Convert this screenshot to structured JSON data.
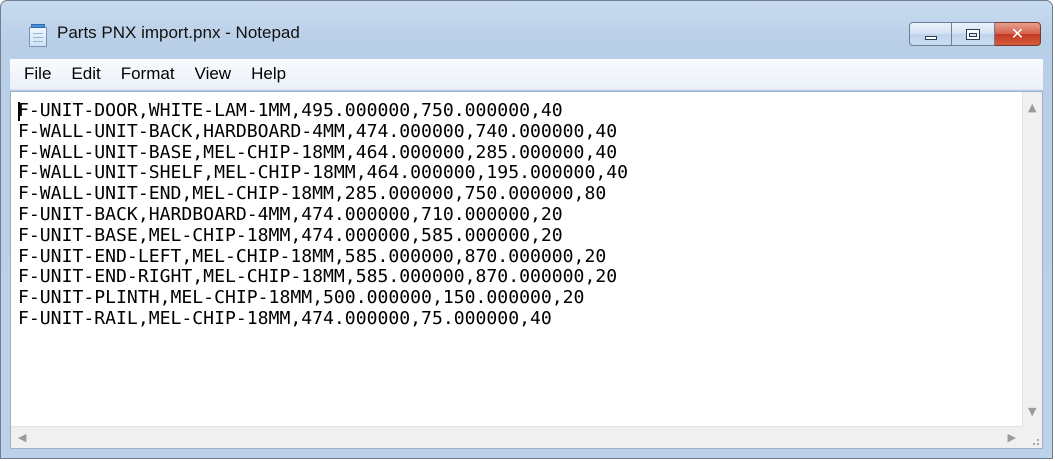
{
  "window": {
    "title": "Parts PNX import.pnx - Notepad",
    "icon": "notepad-icon",
    "controls": {
      "minimize_icon": "minimize-icon",
      "maximize_icon": "maximize-icon",
      "close_icon": "close-icon",
      "close_glyph": "✕"
    }
  },
  "menu": {
    "items": [
      {
        "label": "File"
      },
      {
        "label": "Edit"
      },
      {
        "label": "Format"
      },
      {
        "label": "View"
      },
      {
        "label": "Help"
      }
    ]
  },
  "editor": {
    "lines": [
      "F-UNIT-DOOR,WHITE-LAM-1MM,495.000000,750.000000,40",
      "F-WALL-UNIT-BACK,HARDBOARD-4MM,474.000000,740.000000,40",
      "F-WALL-UNIT-BASE,MEL-CHIP-18MM,464.000000,285.000000,40",
      "F-WALL-UNIT-SHELF,MEL-CHIP-18MM,464.000000,195.000000,40",
      "F-WALL-UNIT-END,MEL-CHIP-18MM,285.000000,750.000000,80",
      "F-UNIT-BACK,HARDBOARD-4MM,474.000000,710.000000,20",
      "F-UNIT-BASE,MEL-CHIP-18MM,474.000000,585.000000,20",
      "F-UNIT-END-LEFT,MEL-CHIP-18MM,585.000000,870.000000,20",
      "F-UNIT-END-RIGHT,MEL-CHIP-18MM,585.000000,870.000000,20",
      "F-UNIT-PLINTH,MEL-CHIP-18MM,500.000000,150.000000,20",
      "F-UNIT-RAIL,MEL-CHIP-18MM,474.000000,75.000000,40"
    ]
  },
  "scrollbars": {
    "up_arrow": "▲",
    "down_arrow": "▼",
    "left_arrow": "◀",
    "right_arrow": "▶"
  },
  "colors": {
    "frame": "#bcd2ea",
    "close_button": "#c13a22"
  }
}
